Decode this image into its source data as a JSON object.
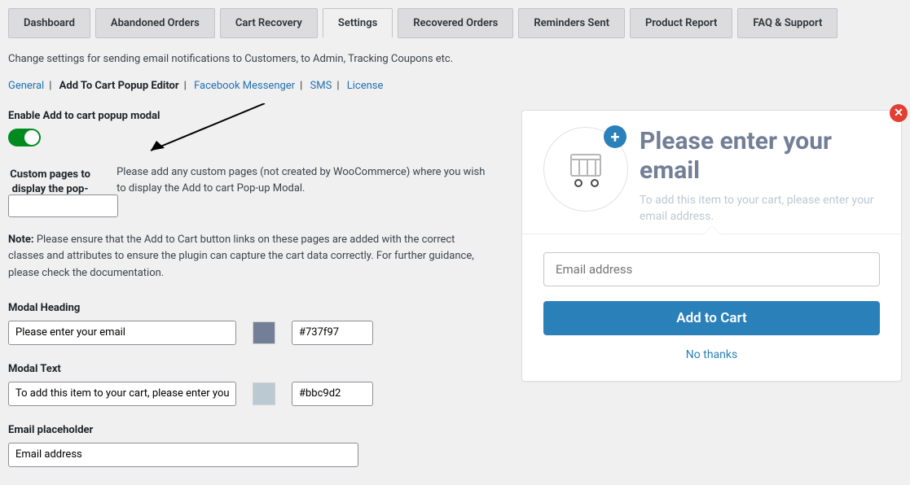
{
  "tabs": [
    "Dashboard",
    "Abandoned Orders",
    "Cart Recovery",
    "Settings",
    "Recovered Orders",
    "Reminders Sent",
    "Product Report",
    "FAQ & Support"
  ],
  "active_tab": "Settings",
  "page_description": "Change settings for sending email notifications to Customers, to Admin, Tracking Coupons etc.",
  "subtabs": {
    "general": "General",
    "atc": "Add To Cart Popup Editor",
    "fb": "Facebook Messenger",
    "sms": "SMS",
    "license": "License"
  },
  "enable_label": "Enable Add to cart popup modal",
  "toggle_on": true,
  "custom_pages": {
    "label": "Custom pages to display the pop-up modal on",
    "help": "Please add any custom pages (not created by WooCommerce) where you wish to display the Add to cart Pop-up Modal."
  },
  "note_prefix": "Note:",
  "note_text": " Please ensure that the Add to Cart button links on these pages are added with the correct classes and attributes to ensure the plugin can capture the cart data correctly. For further guidance, please check the documentation.",
  "fields": {
    "modal_heading_label": "Modal Heading",
    "modal_heading_value": "Please enter your email",
    "modal_heading_color": "#737f97",
    "modal_text_label": "Modal Text",
    "modal_text_value": "To add this item to your cart, please enter your email address.",
    "modal_text_color": "#bbc9d2",
    "email_placeholder_label": "Email placeholder",
    "email_placeholder_value": "Email address"
  },
  "preview": {
    "heading": "Please enter your email",
    "text": "To add this item to your cart, please enter your email address.",
    "email_placeholder": "Email address",
    "button": "Add to Cart",
    "no_thanks": "No thanks"
  }
}
